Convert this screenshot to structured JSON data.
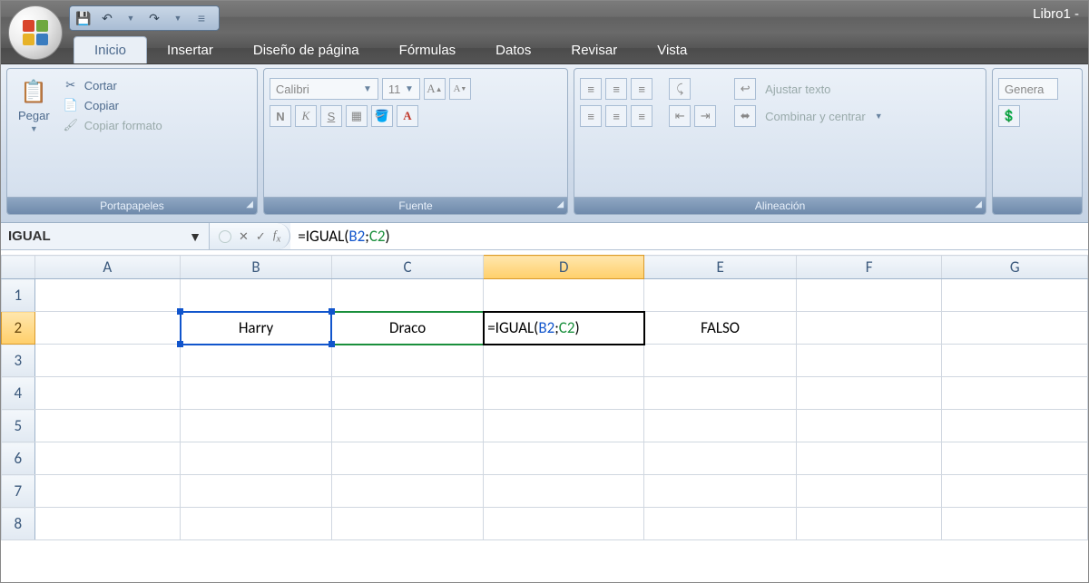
{
  "window": {
    "title": "Libro1 - "
  },
  "tabs": {
    "inicio": "Inicio",
    "insertar": "Insertar",
    "diseno": "Diseño de página",
    "formulas": "Fórmulas",
    "datos": "Datos",
    "revisar": "Revisar",
    "vista": "Vista"
  },
  "ribbon": {
    "clipboard": {
      "title": "Portapapeles",
      "paste": "Pegar",
      "cut": "Cortar",
      "copy": "Copiar",
      "formatPainter": "Copiar formato"
    },
    "font": {
      "title": "Fuente",
      "name": "Calibri",
      "size": "11",
      "bold": "N",
      "italic": "K",
      "underline": "S"
    },
    "alignment": {
      "title": "Alineación",
      "wrap": "Ajustar texto",
      "merge": "Combinar y centrar"
    },
    "number": {
      "title": "",
      "format": "Genera"
    }
  },
  "formulaBar": {
    "nameBox": "IGUAL",
    "prefix": "=IGUAL(",
    "arg1": "B2",
    "sep": ";",
    "arg2": "C2",
    "suffix": ")"
  },
  "grid": {
    "columns": [
      "A",
      "B",
      "C",
      "D",
      "E",
      "F",
      "G"
    ],
    "rows": [
      "1",
      "2",
      "3",
      "4",
      "5",
      "6",
      "7",
      "8"
    ],
    "activeCol": "D",
    "activeRow": "2",
    "cells": {
      "B2": "Harry",
      "C2": "Draco",
      "D2_prefix": "=IGUAL(",
      "D2_arg1": "B2",
      "D2_sep": ";",
      "D2_arg2": "C2",
      "D2_suffix": ")",
      "E2": "FALSO"
    }
  }
}
